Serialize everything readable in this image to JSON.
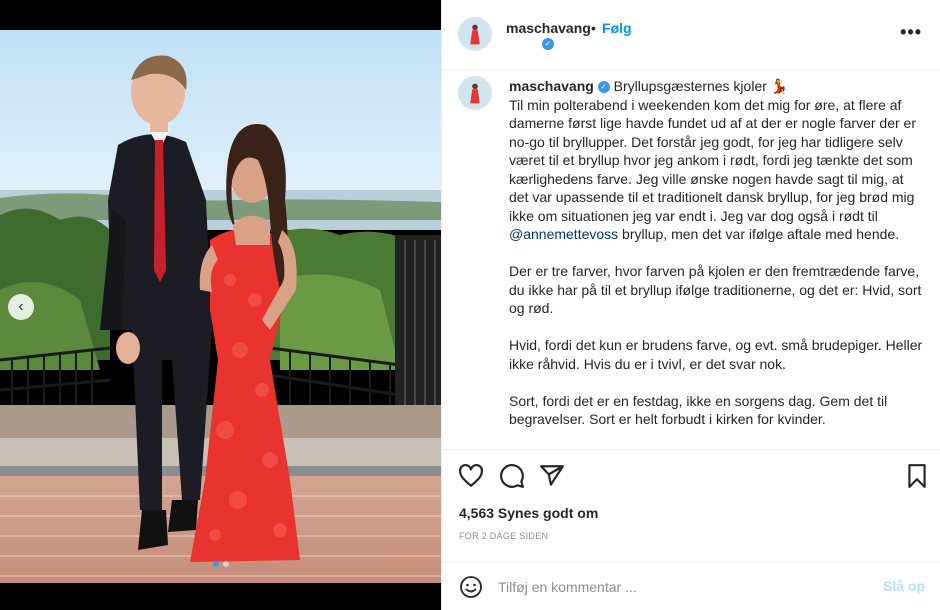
{
  "post": {
    "username": "maschavang",
    "follow_label": "Følg",
    "separator": "•",
    "more_icon": "more-horizontal-icon",
    "caption_title": "Bryllupsgæsternes kjoler",
    "caption_emoji": "💃",
    "caption_p1_before": "Til min polterabend i weekenden kom det mig for øre, at flere af damerne først lige havde fundet ud af at der er nogle farver der er no-go til bryllupper. Det forstår jeg godt, for jeg har tidligere selv været til et bryllup hvor jeg ankom i rødt, fordi jeg tænkte det som kærlighedens farve. Jeg ville ønske nogen havde sagt til mig, at det var upassende til et traditionelt dansk bryllup, for jeg brød mig ikke om situationen jeg var endt i. Jeg var dog også i rødt til ",
    "caption_mention": "@annemettevoss",
    "caption_p1_after": " bryllup, men det var ifølge aftale med hende.",
    "caption_p2": "Der er tre farver, hvor farven på kjolen er den fremtrædende farve, du ikke har på til et bryllup ifølge traditionerne, og det er: Hvid, sort og rød.",
    "caption_p3": "Hvid, fordi det kun er brudens farve, og evt. små brudepiger. Heller ikke råhvid. Hvis du er i tvivl, er det svar nok.",
    "caption_p4": "Sort, fordi det er en festdag, ikke en sorgens dag. Gem det til begravelser. Sort er helt forbudt i kirken for kvinder.",
    "likes": "4,563 Synes godt om",
    "timestamp": "FOR 2 DAGE SIDEN"
  },
  "comment_box": {
    "placeholder": "Tilføj en kommentar ...",
    "post_label": "Slå op"
  },
  "media": {
    "prev_icon": "chevron-left-icon",
    "carousel_index": 1,
    "carousel_count": 2
  },
  "colors": {
    "accent": "#0095f6",
    "verified": "#3897f0",
    "dress": "#e8332f",
    "suit": "#1c1c24"
  }
}
